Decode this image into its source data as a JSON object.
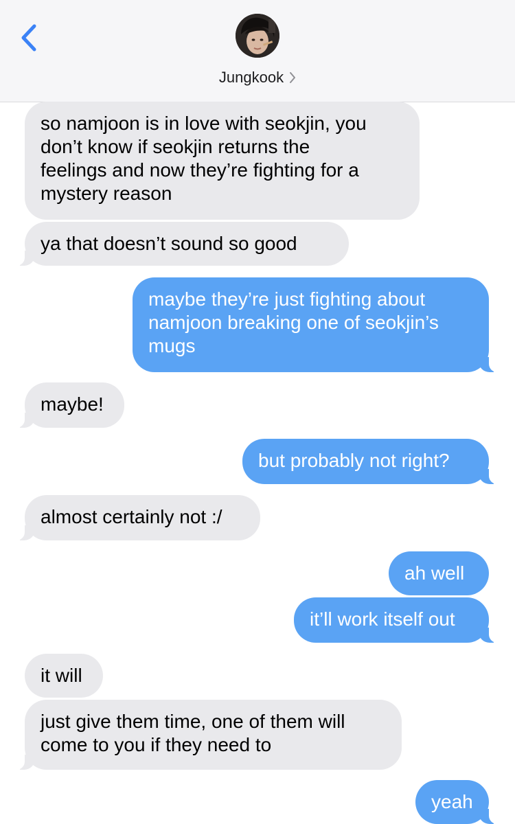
{
  "header": {
    "contact_name": "Jungkook",
    "back_icon": "chevron-left-icon",
    "disclosure_icon": "chevron-right-icon"
  },
  "colors": {
    "accent": "#3b82f6",
    "incoming_bubble": "#e9e9ec",
    "outgoing_bubble": "#5aa3f4",
    "header_bg": "#f6f6f8"
  },
  "messages": [
    {
      "sender": "them",
      "text": "so namjoon is in love with seokjin, you\ndon’t know if seokjin returns the\nfeelings and now they’re fighting for a\nmystery reason"
    },
    {
      "sender": "them",
      "text": "ya that doesn’t sound so good"
    },
    {
      "sender": "me",
      "text": "maybe they’re just fighting about\nnamjoon breaking one of seokjin’s\nmugs"
    },
    {
      "sender": "them",
      "text": "maybe!"
    },
    {
      "sender": "me",
      "text": "but probably not right?"
    },
    {
      "sender": "them",
      "text": "almost certainly not :/"
    },
    {
      "sender": "me",
      "text": "ah well"
    },
    {
      "sender": "me",
      "text": "it’ll work itself out"
    },
    {
      "sender": "them",
      "text": "it will"
    },
    {
      "sender": "them",
      "text": "just give them time, one of them will\ncome to you if they need to"
    },
    {
      "sender": "me",
      "text": "yeah"
    }
  ]
}
